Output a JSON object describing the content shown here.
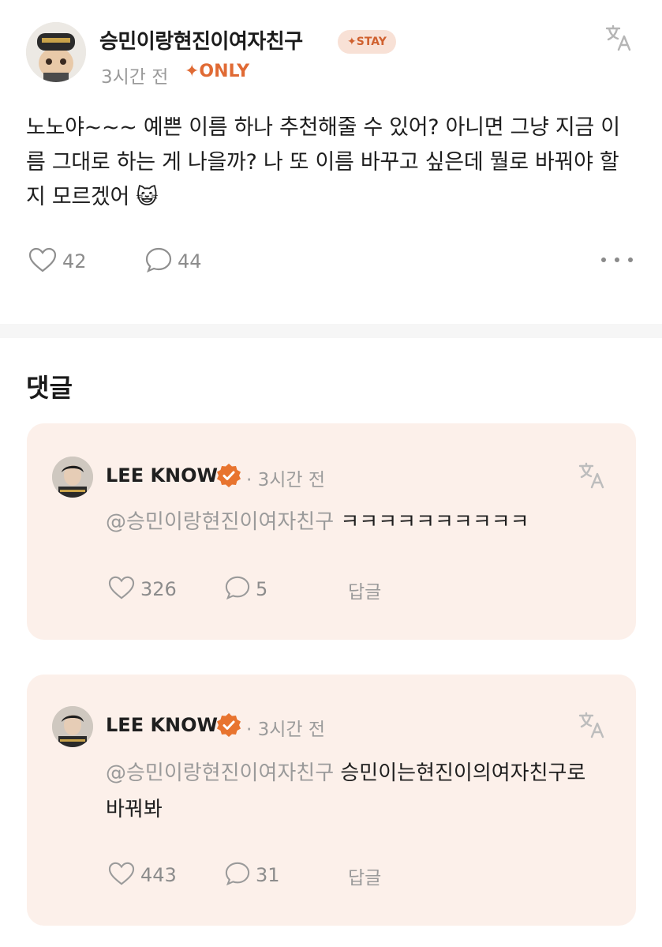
{
  "post": {
    "author": "승민이랑현진이여자친구",
    "badge": "✦STAY",
    "time": "3시간 전",
    "only_label": "✦ONLY",
    "body": "노노야~~~ 예쁜 이름 하나 추천해줄 수 있어? 아니면 그냥 지금 이름 그대로 하는 게 나을까? 나 또 이름 바꾸고 싶은데 뭘로 바꿔야 할지 모르겠어 😺",
    "likes": "42",
    "comments": "44"
  },
  "comments_section": {
    "title": "댓글",
    "items": [
      {
        "author": "LEE KNOW",
        "time": "· 3시간 전",
        "mention": "@승민이랑현진이여자친구",
        "text": " ㅋㅋㅋㅋㅋㅋㅋㅋㅋㅋ",
        "likes": "326",
        "replies": "5",
        "reply_label": "답글"
      },
      {
        "author": "LEE KNOW",
        "time": "· 3시간 전",
        "mention": "@승민이랑현진이여자친구",
        "text": " 승민이는현진이의여자친구로 바꿔봐",
        "likes": "443",
        "replies": "31",
        "reply_label": "답글"
      }
    ]
  },
  "colors": {
    "accent": "#e06a34",
    "card_bg": "#fcf0ea",
    "verified": "#e8742f"
  },
  "icons": [
    "translate-icon",
    "heart-icon",
    "comment-icon",
    "more-icon",
    "verified-icon"
  ]
}
